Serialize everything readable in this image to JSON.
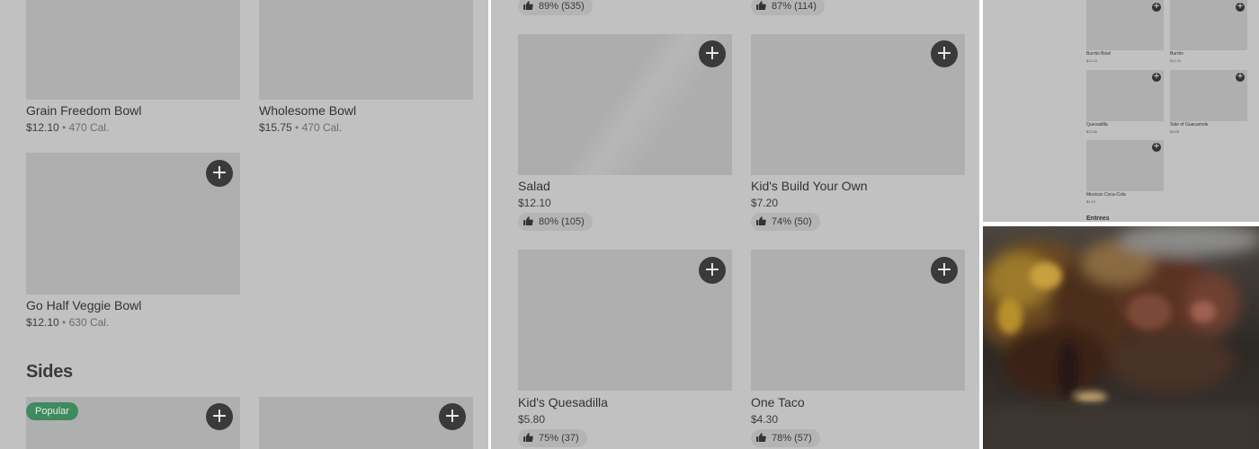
{
  "panel1": {
    "items": [
      {
        "name": "Grain Freedom Bowl",
        "price": "$12.10",
        "calories": "470 Cal."
      },
      {
        "name": "Wholesome Bowl",
        "price": "$15.75",
        "calories": "470 Cal."
      },
      {
        "name": "Go Half Veggie Bowl",
        "price": "$12.10",
        "calories": "630 Cal."
      }
    ],
    "sides_heading": "Sides",
    "popular_badge": "Popular",
    "separator": "•"
  },
  "panel2": {
    "top_ratings": [
      "89% (535)",
      "87% (114)"
    ],
    "items": [
      {
        "name": "Salad",
        "price": "$12.10",
        "rating": "80% (105)"
      },
      {
        "name": "Kid's Build Your Own",
        "price": "$7.20",
        "rating": "74% (50)"
      },
      {
        "name": "Kid's Quesadilla",
        "price": "$5.80",
        "rating": "75% (37)"
      },
      {
        "name": "One Taco",
        "price": "$4.30",
        "rating": "78% (57)"
      }
    ]
  },
  "panel3": {
    "items": [
      {
        "name": "Burrito Bowl",
        "price": "$12.10"
      },
      {
        "name": "Burrito",
        "price": "$12.10"
      },
      {
        "name": "Quesadilla",
        "price": "$12.80"
      },
      {
        "name": "Side of Guacamole",
        "price": "$3.65"
      },
      {
        "name": "Mexican Coca-Cola",
        "price": "$4.10"
      }
    ],
    "section": "Entrees"
  },
  "icons": {
    "add": "plus-icon",
    "rating": "thumbs-up-icon"
  },
  "plus_glyph": "+",
  "colors": {
    "panel_bg": "#c1c1c1",
    "tile": "#afafaf",
    "add_button": "#3a3a3a",
    "popular_badge": "#3f8a5e"
  }
}
